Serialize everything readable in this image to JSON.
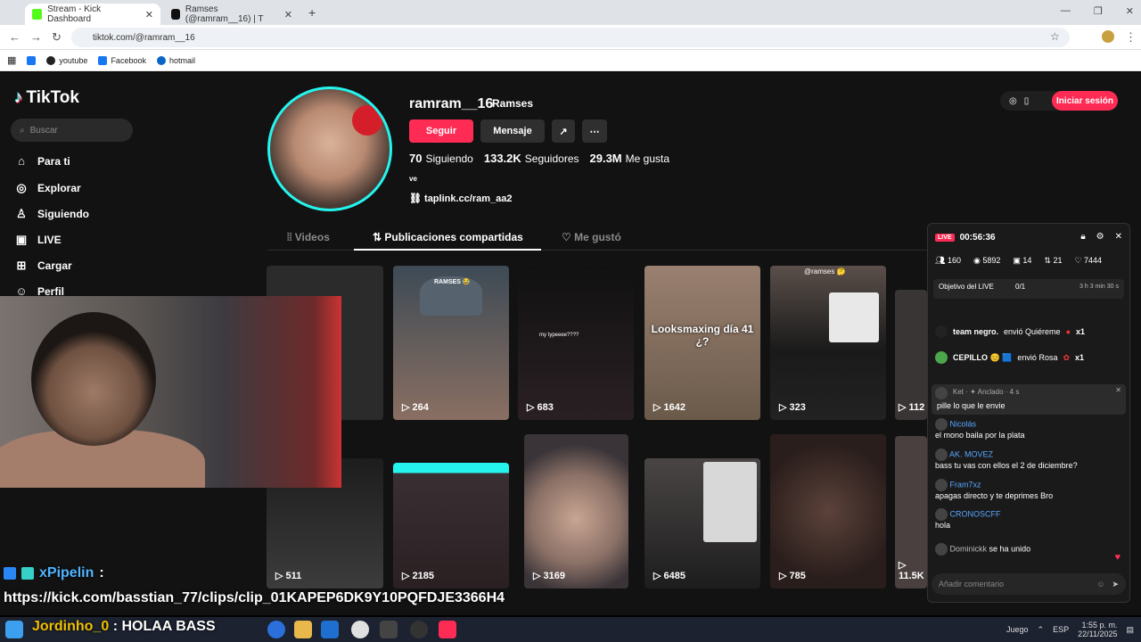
{
  "browser": {
    "tabs": [
      {
        "title": "Stream - Kick Dashboard"
      },
      {
        "title": "Ramses (@ramram__16) | T"
      }
    ],
    "url": "tiktok.com/@ramram__16",
    "bookmarks": [
      "youtube",
      "Facebook",
      "hotmail"
    ]
  },
  "tiktok": {
    "logo": "TikTok",
    "search_placeholder": "Buscar",
    "nav": [
      {
        "label": "Para ti",
        "icon": "home-icon"
      },
      {
        "label": "Explorar",
        "icon": "compass-icon"
      },
      {
        "label": "Siguiendo",
        "icon": "user-icon"
      },
      {
        "label": "LIVE",
        "icon": "live-icon"
      },
      {
        "label": "Cargar",
        "icon": "plus-icon"
      },
      {
        "label": "Perfil",
        "icon": "profile-icon"
      }
    ],
    "login_label": "Iniciar sesión"
  },
  "profile": {
    "username": "ramram__16",
    "nickname": "Ramses",
    "follow_label": "Seguir",
    "message_label": "Mensaje",
    "stats": [
      {
        "value": "70",
        "label": "Siguiendo"
      },
      {
        "value": "133.2K",
        "label": "Seguidores"
      },
      {
        "value": "29.3M",
        "label": "Me gusta"
      }
    ],
    "bio": "ve",
    "link": "taplink.cc/ram_aa2",
    "tabs": [
      "Videos",
      "Publicaciones compartidas",
      "Me gustó"
    ],
    "active_tab": "Publicaciones compartidas"
  },
  "videos": [
    {
      "views": "264",
      "caption": "RAMSES 😂",
      "color": "#3d4a55"
    },
    {
      "views": "683",
      "caption": "my typeeee????",
      "color": "#1e1a1c"
    },
    {
      "views": "1642",
      "caption": "Looksmaxing día 41 ¿?",
      "color": "#6a5a4a"
    },
    {
      "views": "323",
      "caption": "@ramses 🤔",
      "color": "#454040"
    },
    {
      "views": "112",
      "caption": "",
      "color": "#3a3535"
    },
    {
      "views": "511",
      "caption": "",
      "color": "#2a2a2a"
    },
    {
      "views": "2185",
      "caption": "",
      "color": "#3a3034"
    },
    {
      "views": "3169",
      "caption": "",
      "color": "#8a7066"
    },
    {
      "views": "6485",
      "caption": "",
      "color": "#3b3a3a"
    },
    {
      "views": "785",
      "caption": "",
      "color": "#2a1e1c"
    },
    {
      "views": "11.5K",
      "caption": "",
      "color": "#4a4040"
    }
  ],
  "stream_chat": {
    "user1": "xPipelin",
    "msg1": ":",
    "url": "https://kick.com/basstian_77/clips/clip_01KAPEP6DK9Y10PQFDJE3366H4",
    "user2": "Jordinho_0",
    "msg2": ": HOLAA BASS"
  },
  "live_panel": {
    "badge": "LIVE",
    "timer": "00:56:36",
    "stats": [
      "160",
      "5892",
      "14",
      "21",
      "7444"
    ],
    "goal_label": "Objetivo del LIVE",
    "goal_value": "0/1",
    "goal_time": "3 h 3 min 30 s",
    "gifts": [
      {
        "user": "team negro.",
        "text": "envió Quiéreme",
        "count": "x1"
      },
      {
        "user": "CEPILLO 😊 🟦",
        "text": "envió Rosa",
        "count": "x1"
      }
    ],
    "pinned": {
      "user": "Ket",
      "tag": "Anclado",
      "time": "4 s",
      "text": "pille lo que le envie"
    },
    "messages": [
      {
        "user": "Nicolás",
        "text": "el mono baila por la plata"
      },
      {
        "user": "AK. MOVEZ",
        "text": "bass tu vas con ellos el 2 de diciembre?"
      },
      {
        "user": "Fram7xz",
        "text": "apagas directo y te deprimes Bro"
      },
      {
        "user": "CRONOSCFF",
        "text": "hola"
      },
      {
        "user": "Dominickk",
        "text": "se ha unido"
      }
    ],
    "comment_placeholder": "Añadir comentario"
  },
  "taskbar": {
    "weather": "Juego",
    "time": "1:55 p. m.",
    "date": "22/11/2025",
    "lang": "ESP"
  }
}
